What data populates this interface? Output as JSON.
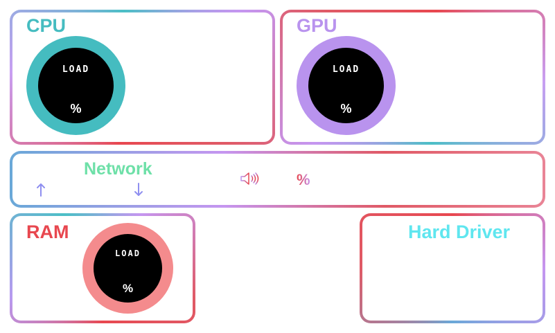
{
  "panels": {
    "cpu": {
      "title": "CPU",
      "gauge_label": "LOAD",
      "value_suffix": "%"
    },
    "gpu": {
      "title": "GPU",
      "gauge_label": "LOAD",
      "value_suffix": "%"
    },
    "network": {
      "title": "Network",
      "value_suffix": "%",
      "icons": [
        "arrow-up-icon",
        "arrow-down-icon",
        "speaker-icon"
      ]
    },
    "ram": {
      "title": "RAM",
      "gauge_label": "LOAD",
      "value_suffix": "%"
    },
    "hard_drive": {
      "title": "Hard Driver"
    }
  },
  "colors": {
    "cpu": "#45bcc0",
    "gpu": "#b993ee",
    "ram_title": "#e8474f",
    "ram_gauge": "#f48b8d",
    "network_title": "#6ee0a8",
    "hard_drive_title": "#5fe6ef",
    "arrows": "#8f8ff0"
  }
}
